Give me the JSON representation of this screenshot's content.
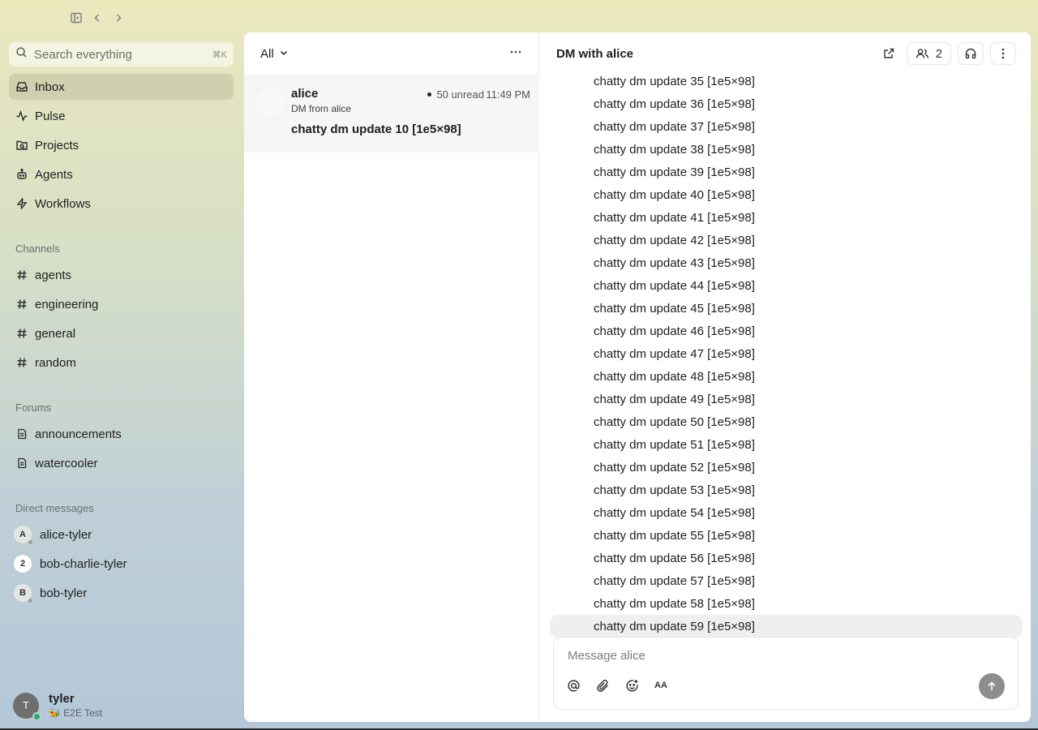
{
  "search": {
    "placeholder": "Search everything",
    "shortcut": "⌘K"
  },
  "nav": [
    {
      "label": "Inbox",
      "icon": "inbox-icon",
      "active": true
    },
    {
      "label": "Pulse",
      "icon": "pulse-icon"
    },
    {
      "label": "Projects",
      "icon": "projects-icon"
    },
    {
      "label": "Agents",
      "icon": "agents-icon"
    },
    {
      "label": "Workflows",
      "icon": "workflows-icon"
    }
  ],
  "channels": {
    "title": "Channels",
    "items": [
      "agents",
      "engineering",
      "general",
      "random"
    ]
  },
  "forums": {
    "title": "Forums",
    "items": [
      "announcements",
      "watercooler"
    ]
  },
  "dms": {
    "title": "Direct messages",
    "items": [
      {
        "label": "alice-tyler",
        "avatar": "A"
      },
      {
        "label": "bob-charlie-tyler",
        "avatar": "2"
      },
      {
        "label": "bob-tyler",
        "avatar": "B"
      }
    ]
  },
  "user": {
    "initial": "T",
    "name": "tyler",
    "status": "🐝 E2E Test"
  },
  "inbox": {
    "filter": "All",
    "item": {
      "from": "alice",
      "subtitle": "DM from alice",
      "unread": "50 unread",
      "time": "11:49 PM",
      "preview": "chatty dm update 10 [1e5×98]"
    }
  },
  "conversation": {
    "title": "DM with alice",
    "member_count": "2",
    "messages": [
      "chatty dm update 35 [1e5×98]",
      "chatty dm update 36 [1e5×98]",
      "chatty dm update 37 [1e5×98]",
      "chatty dm update 38 [1e5×98]",
      "chatty dm update 39 [1e5×98]",
      "chatty dm update 40 [1e5×98]",
      "chatty dm update 41 [1e5×98]",
      "chatty dm update 42 [1e5×98]",
      "chatty dm update 43 [1e5×98]",
      "chatty dm update 44 [1e5×98]",
      "chatty dm update 45 [1e5×98]",
      "chatty dm update 46 [1e5×98]",
      "chatty dm update 47 [1e5×98]",
      "chatty dm update 48 [1e5×98]",
      "chatty dm update 49 [1e5×98]",
      "chatty dm update 50 [1e5×98]",
      "chatty dm update 51 [1e5×98]",
      "chatty dm update 52 [1e5×98]",
      "chatty dm update 53 [1e5×98]",
      "chatty dm update 54 [1e5×98]",
      "chatty dm update 55 [1e5×98]",
      "chatty dm update 56 [1e5×98]",
      "chatty dm update 57 [1e5×98]",
      "chatty dm update 58 [1e5×98]",
      "chatty dm update 59 [1e5×98]"
    ],
    "composer_placeholder": "Message alice",
    "format_label": "AA"
  }
}
